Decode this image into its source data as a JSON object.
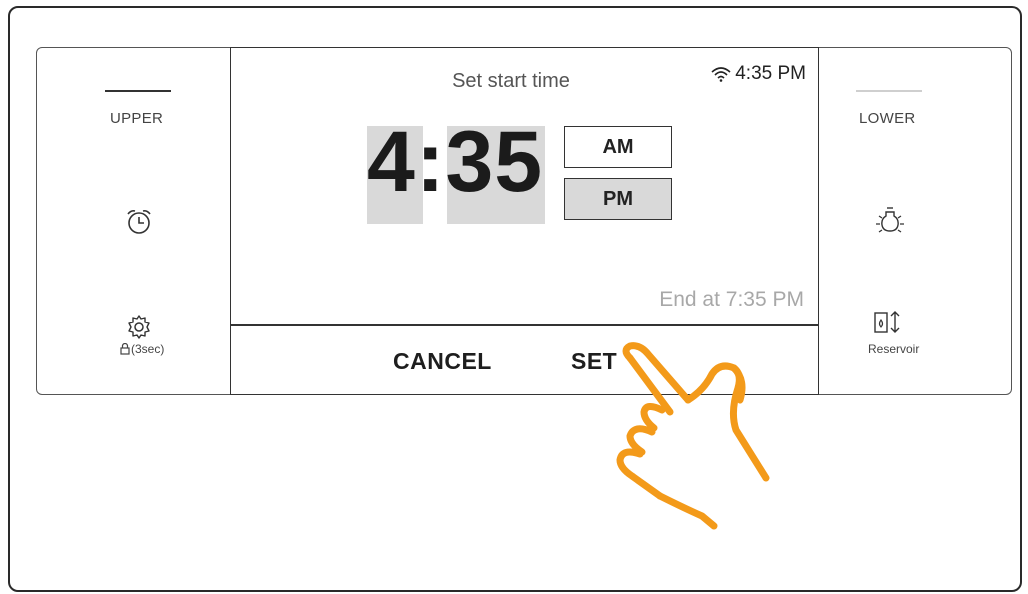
{
  "left": {
    "section_label": "UPPER",
    "alarm_icon": "alarm-clock-icon",
    "settings_icon": "gear-icon",
    "lock_caption": "(3sec)",
    "lock_icon": "lock-icon"
  },
  "right": {
    "section_label": "LOWER",
    "light_icon": "light-bulb-icon",
    "reservoir_icon": "reservoir-icon",
    "reservoir_label": "Reservoir"
  },
  "screen": {
    "title": "Set start time",
    "status_time": "4:35 PM",
    "wifi_icon": "wifi-icon",
    "time_value": "4:35",
    "am_label": "AM",
    "pm_label": "PM",
    "selected_period": "PM",
    "end_text": "End at 7:35 PM",
    "cancel_label": "CANCEL",
    "set_label": "SET"
  },
  "colors": {
    "hand_outline": "#f39a1a",
    "selected_fill": "#d9d9d9"
  },
  "pointer_icon": "tap-hand-icon"
}
